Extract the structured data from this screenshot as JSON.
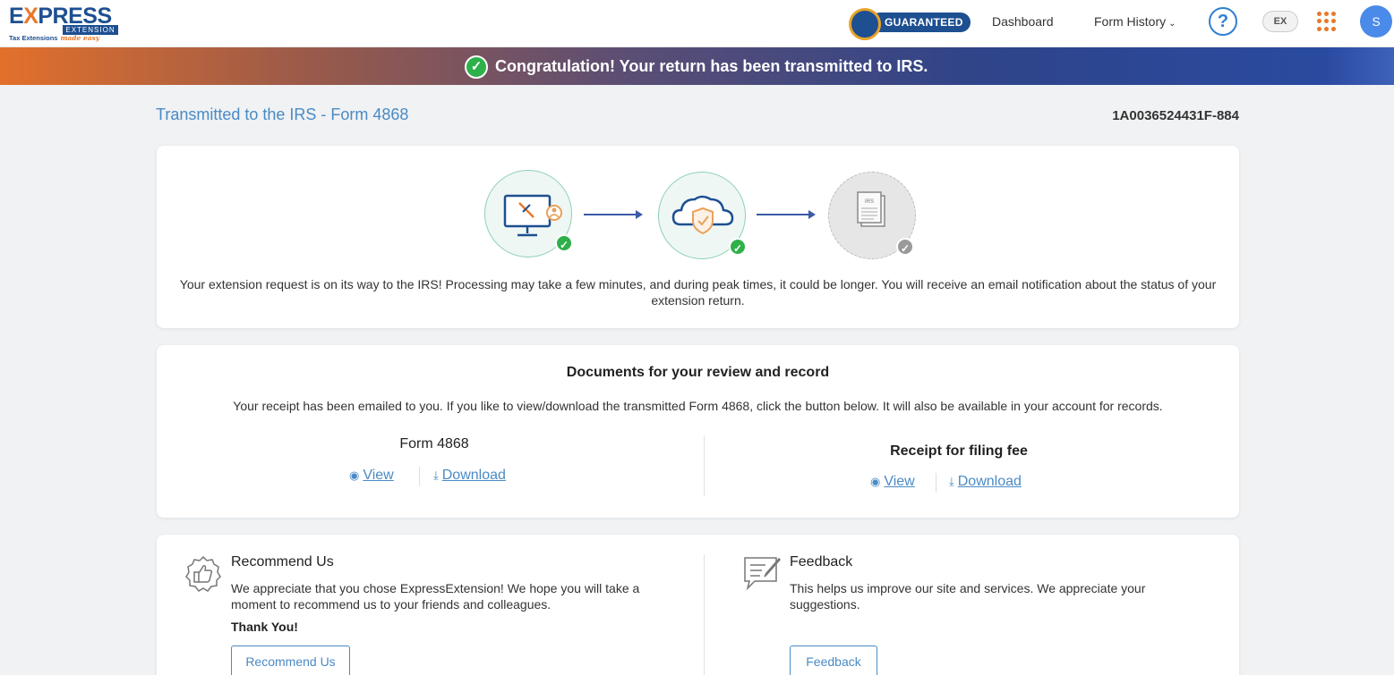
{
  "header": {
    "logo_word_prefix": "E",
    "logo_word_x": "X",
    "logo_word_suffix": "PRESS",
    "logo_sub": "EXTENSION",
    "logo_tag": "Tax Extensions",
    "logo_tag_script": "made easy",
    "badge_label": "GUARANTEED",
    "nav": {
      "dashboard": "Dashboard",
      "form_history": "Form History"
    },
    "help_symbol": "?",
    "ex_icon_text": "EX",
    "avatar_initial": "S"
  },
  "banner": {
    "message": "Congratulation! Your return has been transmitted to IRS."
  },
  "page": {
    "title": "Transmitted to the IRS - Form 4868",
    "reference_number": "1A0036524431F-884"
  },
  "status": {
    "steps": [
      {
        "icon": "computer-user-icon",
        "state": "complete"
      },
      {
        "icon": "cloud-shield-icon",
        "state": "complete"
      },
      {
        "icon": "irs-document-icon",
        "state": "pending",
        "label": "IRS"
      }
    ],
    "message": "Your extension request is on its way to the IRS! Processing may take a few minutes, and during peak times, it could be longer. You will receive an email notification about the status of your extension return."
  },
  "documents": {
    "title": "Documents for your review and record",
    "description": "Your receipt has been emailed to you. If you like to view/download the transmitted Form 4868, click the button below. It will also be available in your account for records.",
    "form": {
      "title": "Form 4868",
      "view_label": "View",
      "download_label": "Download"
    },
    "receipt": {
      "title": "Receipt for filing fee",
      "view_label": "View",
      "download_label": "Download"
    }
  },
  "recommend": {
    "title": "Recommend Us",
    "text": "We appreciate that you chose ExpressExtension! We hope you will take a moment to recommend us to your friends and colleagues.",
    "thanks": "Thank You!",
    "button": "Recommend Us"
  },
  "feedback": {
    "title": "Feedback",
    "text": "This helps us improve our site and services. We appreciate your suggestions.",
    "button": "Feedback"
  },
  "colors": {
    "brand_blue": "#1d4f91",
    "brand_orange": "#e8782a",
    "link_blue": "#4a8ac4",
    "success_green": "#2eb04a"
  }
}
